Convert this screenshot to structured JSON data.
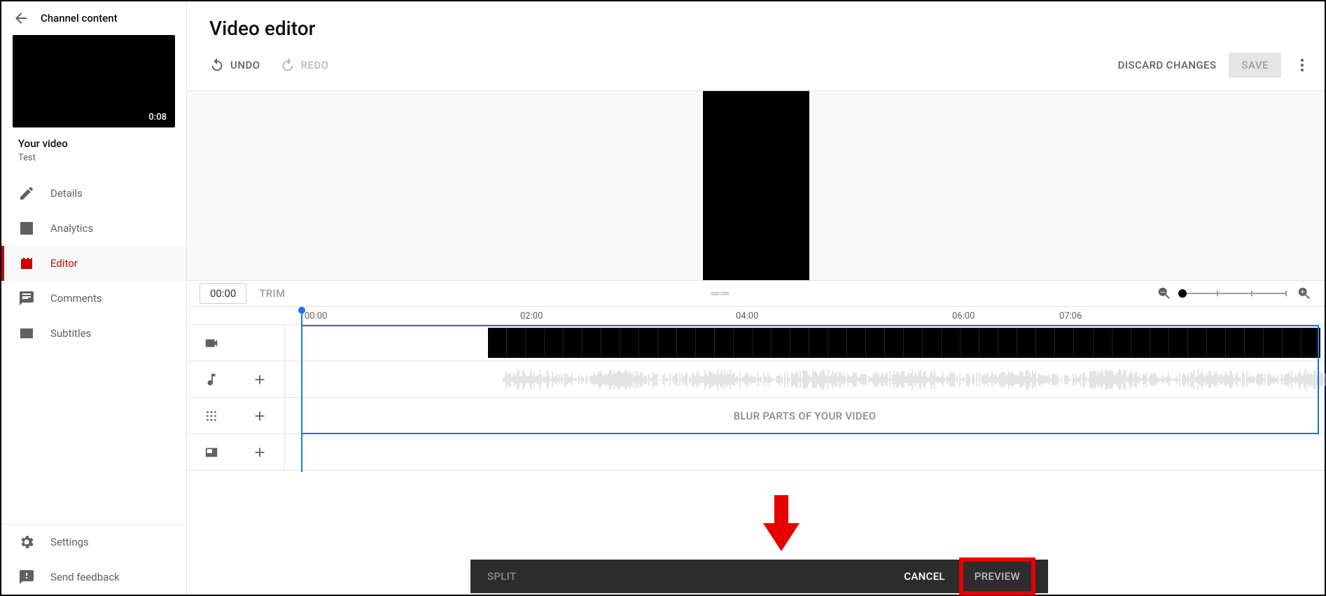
{
  "sidebar": {
    "back_label": "Channel content",
    "thumb_duration": "0:08",
    "your_video_label": "Your video",
    "video_title": "Test",
    "nav": {
      "details": "Details",
      "analytics": "Analytics",
      "editor": "Editor",
      "comments": "Comments",
      "subtitles": "Subtitles",
      "settings": "Settings",
      "feedback": "Send feedback"
    }
  },
  "header": {
    "title": "Video editor"
  },
  "toolbar": {
    "undo": "UNDO",
    "redo": "REDO",
    "discard": "DISCARD CHANGES",
    "save": "SAVE"
  },
  "playback": {
    "time": "00:00",
    "trim": "TRIM"
  },
  "ruler": {
    "t0": "00:00",
    "t1": "02:00",
    "t2": "04:00",
    "t3": "06:00",
    "t4": "07:06"
  },
  "tracks": {
    "blur_text": "BLUR PARTS OF YOUR VIDEO"
  },
  "bottom": {
    "split": "SPLIT",
    "cancel": "CANCEL",
    "preview": "PREVIEW"
  }
}
